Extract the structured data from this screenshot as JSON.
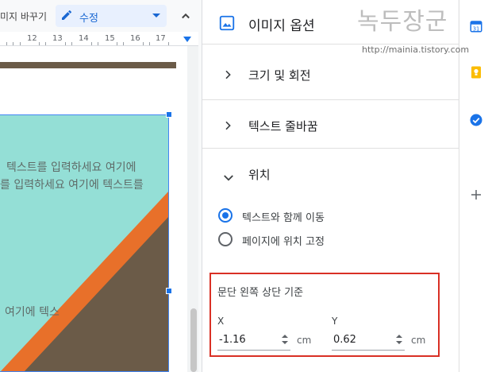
{
  "toolbar": {
    "replace_image_label": "미지 바꾸기",
    "mode_label": "수정"
  },
  "ruler": {
    "numbers": [
      "12",
      "13",
      "14",
      "15",
      "16",
      "17"
    ]
  },
  "document": {
    "image_text_line1": "텍스트를 입력하세요 여기에",
    "image_text_line2": "를 입력하세요 여기에 텍스트를",
    "image_text_line3": "여기에 텍스"
  },
  "panel": {
    "title": "이미지 옵션",
    "sections": {
      "size_rotation": "크기 및 회전",
      "text_wrap": "텍스트 줄바꿈",
      "position": "위치"
    },
    "position": {
      "option_move_with_text": "텍스트와 함께 이동",
      "option_fix_on_page": "페이지에 위치 고정",
      "selected_option": "텍스트와 함께 이동",
      "offset_reference": "문단 왼쪽 상단 기준",
      "x_label": "X",
      "x_value": "-1.16",
      "y_label": "Y",
      "y_value": "0.62",
      "unit": "cm"
    }
  },
  "watermark": {
    "main": "녹두장군",
    "url": "http://mainia.tistory.com"
  },
  "colors": {
    "accent": "#1a73e8",
    "highlight_box": "#d93025",
    "image_teal": "#94dfd6",
    "image_orange": "#e8702a",
    "image_brown": "#6b5b48"
  },
  "icons": [
    "pencil-icon",
    "chevron-up-icon",
    "image-icon",
    "chevron-right-icon",
    "chevron-down-icon",
    "spinner-icon",
    "calendar-icon",
    "keep-icon",
    "tasks-icon",
    "plus-icon"
  ]
}
